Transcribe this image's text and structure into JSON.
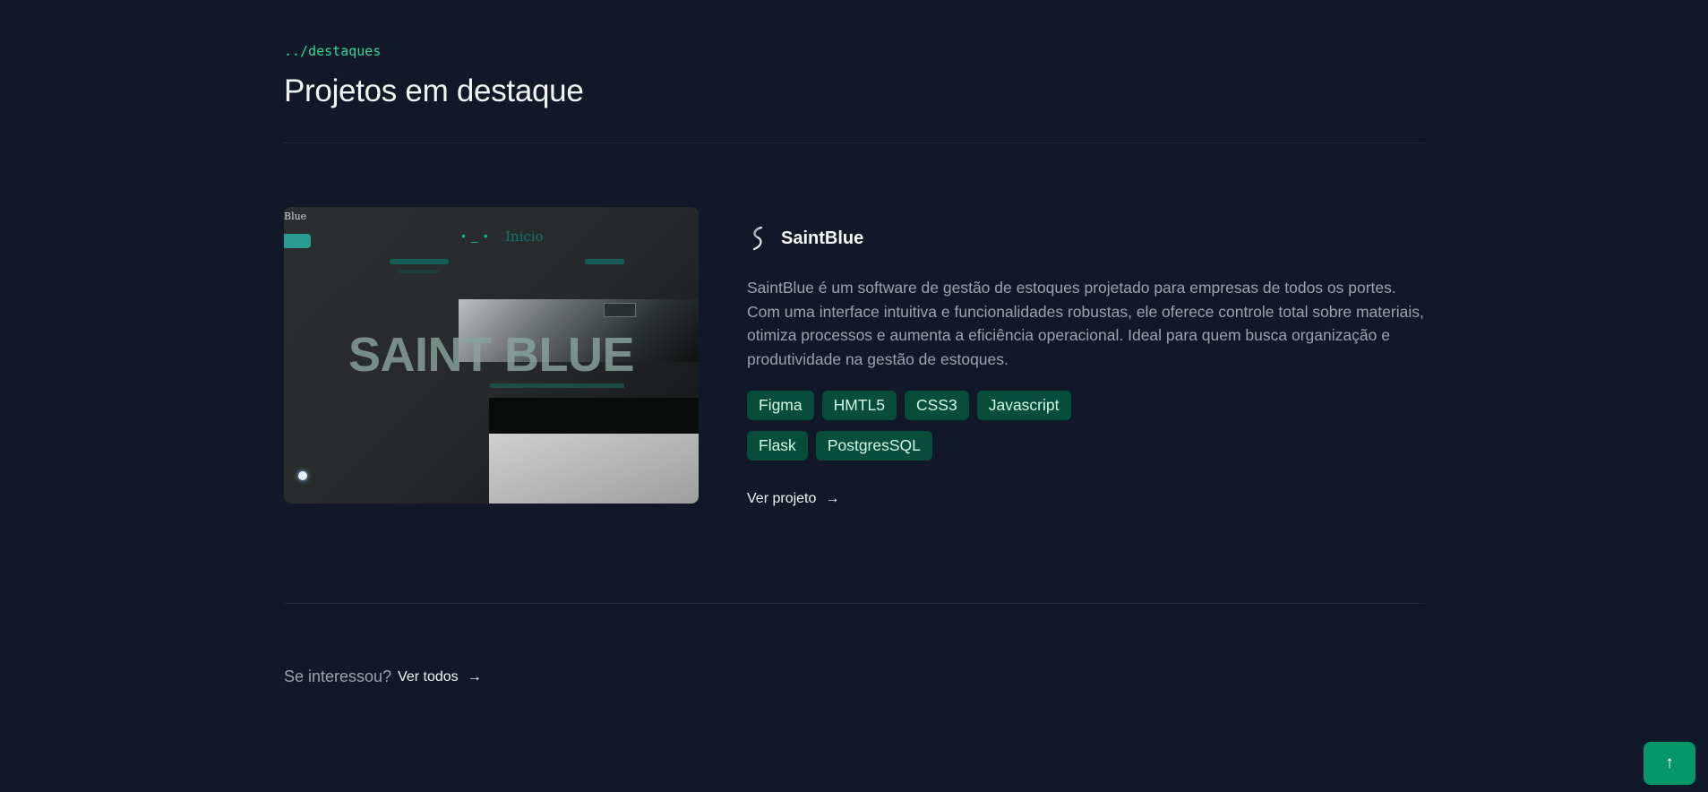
{
  "section": {
    "path_label": "../destaques",
    "title": "Projetos em destaque"
  },
  "project": {
    "name": "SaintBlue",
    "description": "SaintBlue é um software de gestão de estoques projetado para empresas de todos os portes. Com uma interface intuitiva e funcionalidades robustas, ele oferece controle total sobre materiais, otimiza processos e aumenta a eficiência operacional. Ideal para quem busca organização e produtividade na gestão de estoques.",
    "tags": [
      "Figma",
      "HMTL5",
      "CSS3",
      "Javascript",
      "Flask",
      "PostgresSQL"
    ],
    "link_label": "Ver projeto",
    "link_arrow": "→",
    "thumbnail": {
      "corner_text": "Blue",
      "nav_dots": "•_•",
      "nav_label": "Inicio",
      "big_text": "SAINT BLUE"
    }
  },
  "footer": {
    "question": "Se interessou?",
    "link_label": "Ver todos",
    "link_arrow": "→"
  },
  "scroll_top": {
    "icon": "arrow-up-icon",
    "glyph": "↑"
  },
  "colors": {
    "background": "#111827",
    "accent": "#34d399",
    "tag_bg": "#064e3b",
    "tag_text": "#d1fae5",
    "button": "#059669"
  }
}
